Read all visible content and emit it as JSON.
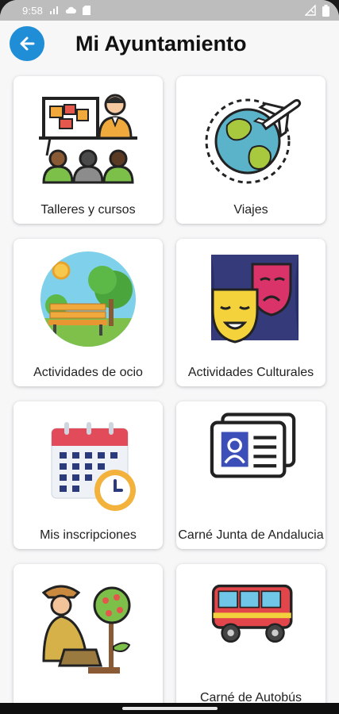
{
  "status_bar": {
    "time": "9:58",
    "icons": [
      "signal-icon",
      "cloud-icon",
      "sd-card-icon",
      "cell-signal-icon",
      "battery-icon"
    ]
  },
  "header": {
    "title": "Mi Ayuntamiento",
    "back_icon": "arrow-left-icon",
    "accent_color": "#1f8ed6"
  },
  "tiles": [
    {
      "label": "Talleres y cursos",
      "icon": "workshop-presentation-icon"
    },
    {
      "label": "Viajes",
      "icon": "globe-airplane-icon"
    },
    {
      "label": "Actividades de ocio",
      "icon": "park-bench-icon"
    },
    {
      "label": "Actividades Culturales",
      "icon": "theater-masks-icon"
    },
    {
      "label": "Mis inscripciones",
      "icon": "calendar-clock-icon"
    },
    {
      "label": "Carné Junta de Andalucia",
      "icon": "id-card-icon"
    },
    {
      "label": "",
      "icon": "gardener-tree-icon"
    },
    {
      "label": "Carné de Autobús",
      "icon": "bus-icon"
    }
  ]
}
